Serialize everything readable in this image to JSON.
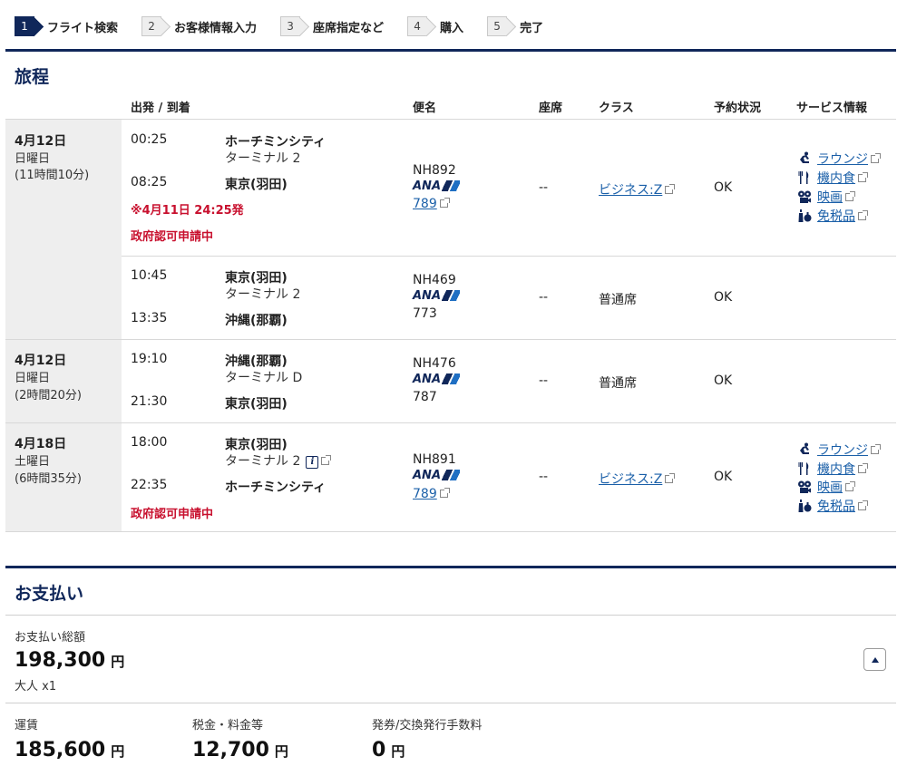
{
  "steps": [
    {
      "num": "1",
      "label": "フライト検索"
    },
    {
      "num": "2",
      "label": "お客様情報入力"
    },
    {
      "num": "3",
      "label": "座席指定など"
    },
    {
      "num": "4",
      "label": "購入"
    },
    {
      "num": "5",
      "label": "完了"
    }
  ],
  "itinerary": {
    "title": "旅程",
    "headers": {
      "depart_arrive": "出発 / 到着",
      "flight": "便名",
      "seat": "座席",
      "class": "クラス",
      "status": "予約状況",
      "service": "サービス情報"
    },
    "segments": [
      {
        "date": "4月12日",
        "weekday": "日曜日",
        "duration": "(11時間10分)",
        "dep_time": "00:25",
        "dep_place": "ホーチミンシティ",
        "dep_terminal": "ターミナル 2",
        "arr_time": "08:25",
        "arr_place": "東京(羽田)",
        "arr_terminal": "",
        "notes": [
          "※4月11日 24:25発",
          "政府認可申請中"
        ],
        "flight_no": "NH892",
        "airline": "ANA",
        "aircraft": "789",
        "seat": "--",
        "class": "ビジネス:Z",
        "status": "OK",
        "services": [
          "ラウンジ",
          "機内食",
          "映画",
          "免税品"
        ]
      },
      {
        "date": "",
        "weekday": "",
        "duration": "",
        "dep_time": "10:45",
        "dep_place": "東京(羽田)",
        "dep_terminal": "ターミナル 2",
        "arr_time": "13:35",
        "arr_place": "沖縄(那覇)",
        "notes": [],
        "flight_no": "NH469",
        "airline": "ANA",
        "aircraft": "773",
        "seat": "--",
        "class": "普通席",
        "status": "OK",
        "services": []
      },
      {
        "date": "4月12日",
        "weekday": "日曜日",
        "duration": "(2時間20分)",
        "dep_time": "19:10",
        "dep_place": "沖縄(那覇)",
        "dep_terminal": "ターミナル D",
        "arr_time": "21:30",
        "arr_place": "東京(羽田)",
        "notes": [],
        "flight_no": "NH476",
        "airline": "ANA",
        "aircraft": "787",
        "seat": "--",
        "class": "普通席",
        "status": "OK",
        "services": []
      },
      {
        "date": "4月18日",
        "weekday": "土曜日",
        "duration": "(6時間35分)",
        "dep_time": "18:00",
        "dep_place": "東京(羽田)",
        "dep_terminal": "ターミナル 2",
        "arr_time": "22:35",
        "arr_place": "ホーチミンシティ",
        "notes": [
          "政府認可申請中"
        ],
        "flight_no": "NH891",
        "airline": "ANA",
        "aircraft": "789",
        "seat": "--",
        "class": "ビジネス:Z",
        "status": "OK",
        "services": [
          "ラウンジ",
          "機内食",
          "映画",
          "免税品"
        ]
      }
    ]
  },
  "payment": {
    "title": "お支払い",
    "total_label": "お支払い総額",
    "total": "198,300",
    "currency": "円",
    "passengers": "大人 x1",
    "breakdown": [
      {
        "label": "運賃",
        "amount": "185,600"
      },
      {
        "label": "税金・料金等",
        "amount": "12,700"
      },
      {
        "label": "発券/交換発行手数料",
        "amount": "0"
      }
    ]
  },
  "colors": {
    "brand_navy": "#10275a",
    "link_blue": "#1a5fa8",
    "warning_red": "#c8102e",
    "date_bg": "#eeeeee"
  }
}
